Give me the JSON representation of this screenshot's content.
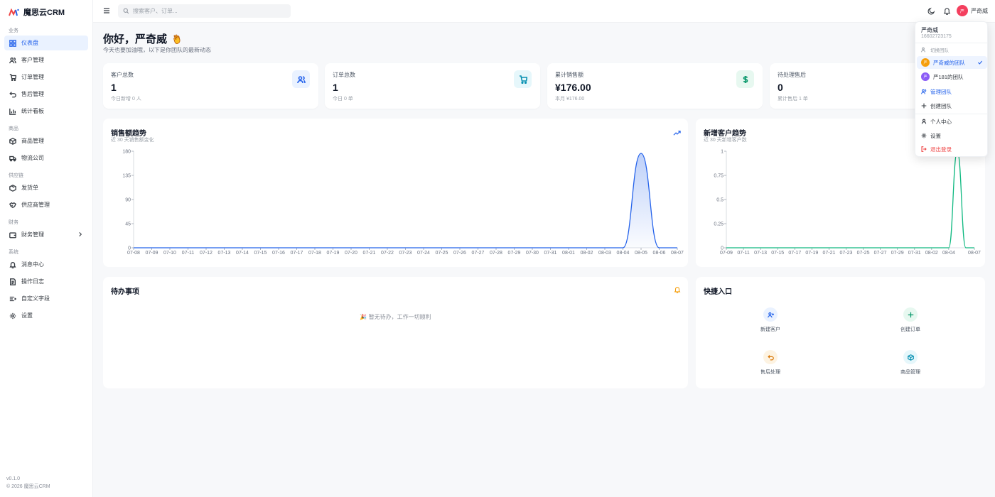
{
  "app": {
    "name": "魔思云CRM"
  },
  "sidebar": {
    "sections": [
      {
        "label": "业务",
        "items": [
          {
            "label": "仪表盘",
            "icon": "dashboard-icon",
            "active": true
          },
          {
            "label": "客户管理",
            "icon": "users-icon"
          },
          {
            "label": "订单管理",
            "icon": "cart-icon"
          },
          {
            "label": "售后管理",
            "icon": "undo-icon"
          },
          {
            "label": "统计看板",
            "icon": "bar-chart-icon"
          }
        ]
      },
      {
        "label": "商品",
        "items": [
          {
            "label": "商品管理",
            "icon": "package-icon"
          },
          {
            "label": "物流公司",
            "icon": "truck-icon"
          }
        ]
      },
      {
        "label": "供应链",
        "items": [
          {
            "label": "发货单",
            "icon": "box-icon"
          },
          {
            "label": "供应商管理",
            "icon": "handshake-icon"
          }
        ]
      },
      {
        "label": "财务",
        "items": [
          {
            "label": "财务管理",
            "icon": "wallet-icon",
            "has_children": true
          }
        ]
      },
      {
        "label": "系统",
        "items": [
          {
            "label": "消息中心",
            "icon": "bell-icon"
          },
          {
            "label": "操作日志",
            "icon": "log-icon"
          },
          {
            "label": "自定义字段",
            "icon": "fields-icon"
          },
          {
            "label": "设置",
            "icon": "gear-icon"
          }
        ]
      }
    ],
    "version": "v0.1.0",
    "copyright": "© 2026 魔思云CRM"
  },
  "topbar": {
    "search_placeholder": "搜索客户、订单...",
    "user_name": "严奇威",
    "avatar_text": "严"
  },
  "greeting": {
    "title": "你好，严奇威",
    "subtitle": "今天也要加油哦，以下是你团队的最新动态"
  },
  "stats": [
    {
      "title": "客户总数",
      "value": "1",
      "sub": "今日新增 0 人",
      "icon": "users-icon",
      "color": "#2563eb",
      "bg": "#eaf2ff"
    },
    {
      "title": "订单总数",
      "value": "1",
      "sub": "今日 0 单",
      "icon": "cart-icon",
      "color": "#0891b2",
      "bg": "#e6f7fb"
    },
    {
      "title": "累计销售额",
      "value": "¥176.00",
      "sub": "本月 ¥176.00",
      "icon": "dollar-icon",
      "color": "#059669",
      "bg": "#e7f8f0"
    },
    {
      "title": "待处理售后",
      "value": "0",
      "sub": "累计售后 1 单",
      "icon": "undo-icon",
      "color": "#d97706",
      "bg": "#fdf3e2"
    }
  ],
  "charts": {
    "sales": {
      "title": "销售额趋势",
      "subtitle": "近 30 天销售额变化"
    },
    "customers": {
      "title": "新增客户趋势",
      "subtitle": "近 30 天新增客户数"
    }
  },
  "chart_data": [
    {
      "type": "area",
      "title": "销售额趋势",
      "color": "#2563eb",
      "ylim": [
        0,
        180
      ],
      "yticks": [
        "0",
        "45",
        "90",
        "135",
        "180"
      ],
      "x": [
        "07-08",
        "07-09",
        "07-10",
        "07-11",
        "07-12",
        "07-13",
        "07-14",
        "07-15",
        "07-16",
        "07-17",
        "07-18",
        "07-19",
        "07-20",
        "07-21",
        "07-22",
        "07-23",
        "07-24",
        "07-25",
        "07-26",
        "07-27",
        "07-28",
        "07-29",
        "07-30",
        "07-31",
        "08-01",
        "08-02",
        "08-03",
        "08-04",
        "08-05",
        "08-06",
        "08-07"
      ],
      "values": [
        0,
        0,
        0,
        0,
        0,
        0,
        0,
        0,
        0,
        0,
        0,
        0,
        0,
        0,
        0,
        0,
        0,
        0,
        0,
        0,
        0,
        0,
        0,
        0,
        0,
        0,
        0,
        0,
        176,
        0,
        0
      ]
    },
    {
      "type": "line",
      "title": "新增客户趋势",
      "color": "#10b981",
      "ylim": [
        0,
        1
      ],
      "yticks": [
        "0",
        "0.25",
        "0.5",
        "0.75",
        "1"
      ],
      "x": [
        "07-09",
        "07-10",
        "07-11",
        "07-12",
        "07-13",
        "07-14",
        "07-15",
        "07-16",
        "07-17",
        "07-18",
        "07-19",
        "07-20",
        "07-21",
        "07-22",
        "07-23",
        "07-24",
        "07-25",
        "07-26",
        "07-27",
        "07-28",
        "07-29",
        "07-30",
        "07-31",
        "08-01",
        "08-02",
        "08-03",
        "08-04",
        "08-05",
        "08-06",
        "08-07"
      ],
      "xticks": [
        "07-09",
        "07-11",
        "07-13",
        "07-15",
        "07-17",
        "07-19",
        "07-21",
        "07-23",
        "07-25",
        "07-27",
        "07-29",
        "07-31",
        "08-02",
        "08-04",
        "08-07"
      ],
      "values": [
        0,
        0,
        0,
        0,
        0,
        0,
        0,
        0,
        0,
        0,
        0,
        0,
        0,
        0,
        0,
        0,
        0,
        0,
        0,
        0,
        0,
        0,
        0,
        0,
        0,
        0,
        0,
        1,
        0,
        0
      ]
    }
  ],
  "todo": {
    "title": "待办事项",
    "empty": "🎉 暂无待办，工作一切顺利"
  },
  "quick": {
    "title": "快捷入口",
    "items": [
      {
        "label": "新建客户",
        "icon": "user-plus-icon",
        "color": "#2563eb",
        "bg": "#eaf2ff"
      },
      {
        "label": "创建订单",
        "icon": "plus-icon",
        "color": "#059669",
        "bg": "#e7f8f0"
      },
      {
        "label": "售后处理",
        "icon": "undo-icon",
        "color": "#d97706",
        "bg": "#fdf3e2"
      },
      {
        "label": "商品管理",
        "icon": "package-icon",
        "color": "#0891b2",
        "bg": "#e6f7fb"
      }
    ]
  },
  "dropdown": {
    "name": "严奇威",
    "phone": "16602723175",
    "switch_label": "切换团队",
    "teams": [
      {
        "label": "严奇威的团队",
        "badge": "严",
        "color": "#f59e0b",
        "selected": true
      },
      {
        "label": "严181的团队",
        "badge": "严",
        "color": "#8b5cf6",
        "selected": false
      }
    ],
    "manage_team": "管理团队",
    "create_team": "创建团队",
    "profile": "个人中心",
    "settings": "设置",
    "logout": "退出登录"
  }
}
